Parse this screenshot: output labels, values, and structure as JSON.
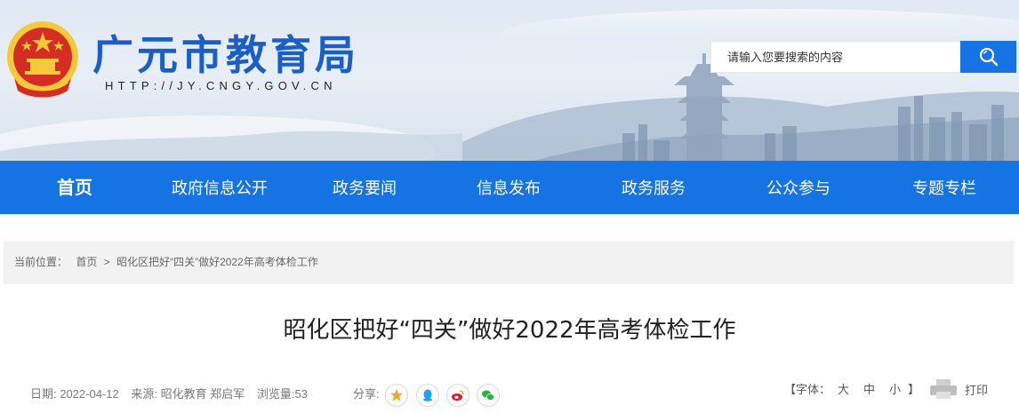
{
  "header": {
    "site_title": "广元市教育局",
    "site_url": "HTTP://JY.CNGY.GOV.CN",
    "emblem_icon": "national-emblem-icon",
    "search": {
      "placeholder": "请输入您要搜索的内容",
      "value": "",
      "button_icon": "search-icon"
    }
  },
  "nav": {
    "items": [
      {
        "label": "首页",
        "active": true
      },
      {
        "label": "政府信息公开",
        "active": false
      },
      {
        "label": "政务要闻",
        "active": false
      },
      {
        "label": "信息发布",
        "active": false
      },
      {
        "label": "政务服务",
        "active": false
      },
      {
        "label": "公众参与",
        "active": false
      },
      {
        "label": "专题专栏",
        "active": false
      }
    ]
  },
  "breadcrumb": {
    "prefix": "当前位置：",
    "home": "首页",
    "separator": ">",
    "current": "昭化区把好“四关”做好2022年高考体检工作"
  },
  "article": {
    "title": "昭化区把好“四关”做好2022年高考体检工作",
    "date": "日期: 2022-04-12",
    "source": "来源: 昭化教育 郑启军",
    "views": "浏览量:53",
    "share_label": "分享:",
    "share_icons": [
      "qzone-icon",
      "qq-icon",
      "weibo-icon",
      "wechat-icon"
    ]
  },
  "font_size": {
    "label_open": "【字体：",
    "large": "大",
    "medium": "中",
    "small": "小",
    "label_close": "】"
  },
  "print": {
    "label": "打印",
    "icon": "printer-icon"
  },
  "colors": {
    "primary": "#1673e4",
    "title_blue": "#1a5fc7",
    "emblem_red": "#d42d24",
    "emblem_gold": "#f5c93a",
    "crumb_bg": "#f2f2f2"
  }
}
